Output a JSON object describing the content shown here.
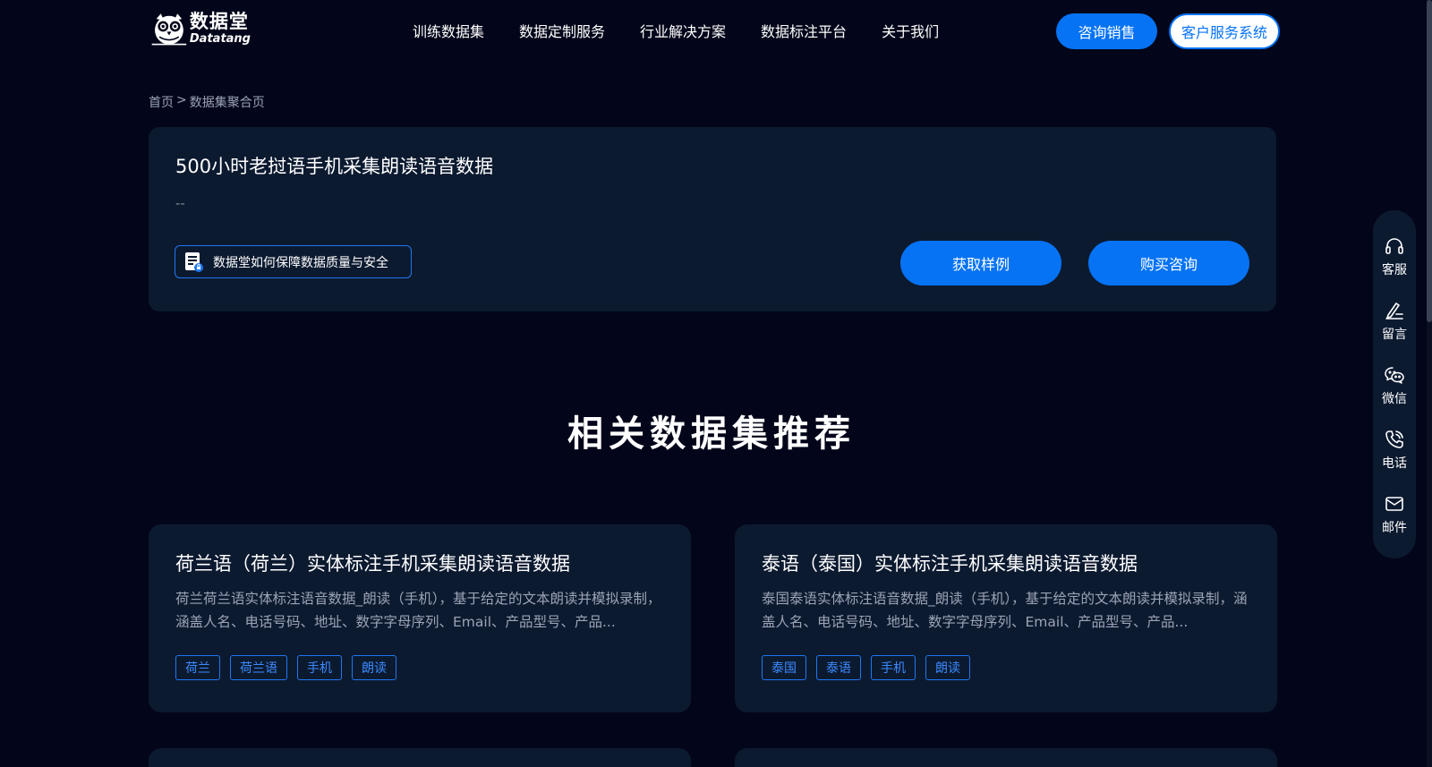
{
  "header": {
    "logo": {
      "cn": "数据堂",
      "en": "Datatang"
    },
    "nav": [
      "训练数据集",
      "数据定制服务",
      "行业解决方案",
      "数据标注平台",
      "关于我们"
    ],
    "sales_button": "咨询销售",
    "service_button": "客户服务系统"
  },
  "breadcrumb": {
    "home": "首页",
    "separator": ">",
    "current": "数据集聚合页"
  },
  "detail": {
    "title": "500小时老挝语手机采集朗读语音数据",
    "subtitle": "--",
    "quality_link": "数据堂如何保障数据质量与安全",
    "sample_button": "获取样例",
    "buy_button": "购买咨询"
  },
  "section": {
    "title": "相关数据集推荐"
  },
  "recommendations": [
    {
      "title": "荷兰语（荷兰）实体标注手机采集朗读语音数据",
      "desc": "荷兰荷兰语实体标注语音数据_朗读（手机），基于给定的文本朗读并模拟录制，涵盖人名、电话号码、地址、数字字母序列、Email、产品型号、产品...",
      "tags": [
        "荷兰",
        "荷兰语",
        "手机",
        "朗读"
      ]
    },
    {
      "title": "泰语（泰国）实体标注手机采集朗读语音数据",
      "desc": "泰国泰语实体标注语音数据_朗读（手机），基于给定的文本朗读并模拟录制，涵盖人名、电话号码、地址、数字字母序列、Email、产品型号、产品...",
      "tags": [
        "泰国",
        "泰语",
        "手机",
        "朗读"
      ]
    }
  ],
  "float_bar": [
    {
      "icon": "headset-icon",
      "label": "客服"
    },
    {
      "icon": "pen-icon",
      "label": "留言"
    },
    {
      "icon": "wechat-icon",
      "label": "微信"
    },
    {
      "icon": "phone-icon",
      "label": "电话"
    },
    {
      "icon": "mail-icon",
      "label": "邮件"
    }
  ],
  "colors": {
    "background": "#03061a",
    "card": "#0c1a30",
    "accent": "#0673f5",
    "muted_text": "#9ba3b7"
  }
}
